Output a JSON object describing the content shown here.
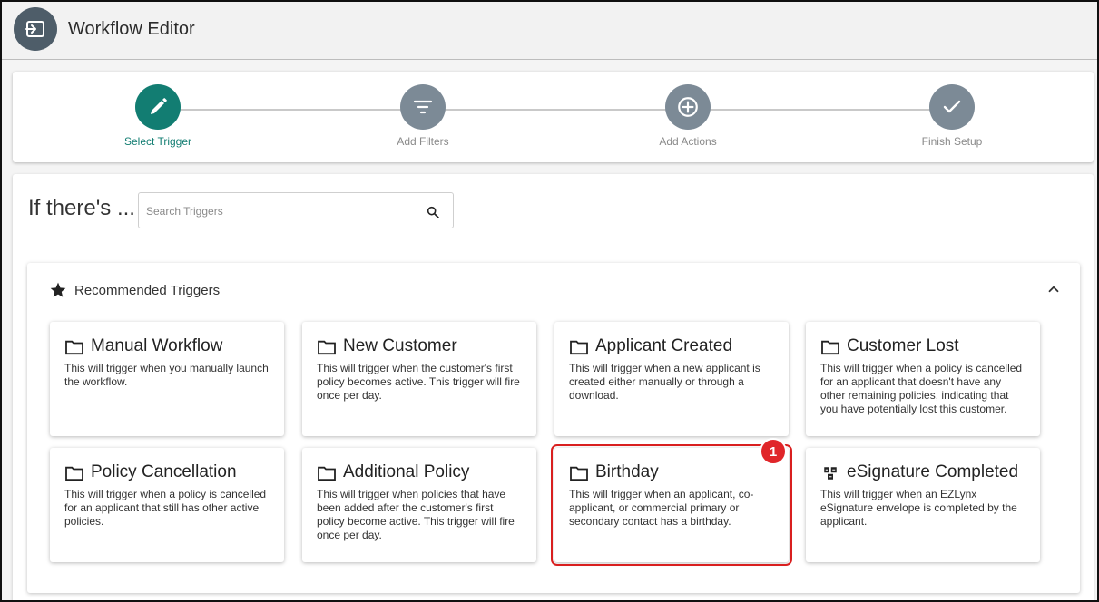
{
  "header": {
    "title": "Workflow Editor",
    "icon": "exit-to-app-icon"
  },
  "stepper": {
    "steps": [
      {
        "label": "Select Trigger",
        "icon": "pencil-icon",
        "active": true
      },
      {
        "label": "Add Filters",
        "icon": "filter-icon",
        "active": false
      },
      {
        "label": "Add Actions",
        "icon": "plus-circle-icon",
        "active": false
      },
      {
        "label": "Finish Setup",
        "icon": "check-icon",
        "active": false
      }
    ]
  },
  "main": {
    "title": "If there's ...",
    "search": {
      "placeholder": "Search Triggers",
      "value": ""
    }
  },
  "recommended": {
    "title": "Recommended Triggers",
    "cards": [
      {
        "title": "Manual Workflow",
        "desc": "This will trigger when you manually launch the workflow.",
        "icon": "folder-icon"
      },
      {
        "title": "New Customer",
        "desc": "This will trigger when the customer's first policy becomes active. This trigger will fire once per day.",
        "icon": "folder-icon"
      },
      {
        "title": "Applicant Created",
        "desc": "This will trigger when a new applicant is created either manually or through a download.",
        "icon": "folder-icon"
      },
      {
        "title": "Customer Lost",
        "desc": "This will trigger when a policy is cancelled for an applicant that doesn't have any other remaining policies, indicating that you have potentially lost this customer.",
        "icon": "folder-icon"
      },
      {
        "title": "Policy Cancellation",
        "desc": "This will trigger when a policy is cancelled for an applicant that still has other active policies.",
        "icon": "folder-icon"
      },
      {
        "title": "Additional Policy",
        "desc": "This will trigger when policies that have been added after the customer's first policy become active. This trigger will fire once per day.",
        "icon": "folder-icon"
      },
      {
        "title": "Birthday",
        "desc": "This will trigger when an applicant, co-applicant, or commercial primary or secondary contact has a birthday.",
        "icon": "folder-icon"
      },
      {
        "title": "eSignature Completed",
        "desc": "This will trigger when an EZLynx eSignature envelope is completed by the applicant.",
        "icon": "signature-icon"
      }
    ]
  },
  "annotation": {
    "badge": "1"
  },
  "colors": {
    "accent": "#127d72",
    "inactive_step": "#7c8a96",
    "header_icon_bg": "#4e5d69",
    "highlight": "#d91f1f"
  }
}
